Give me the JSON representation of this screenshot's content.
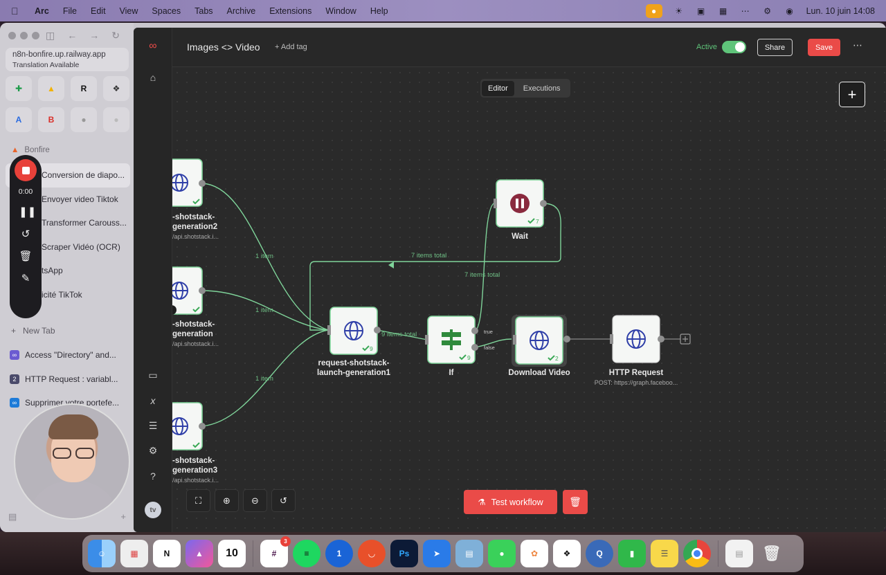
{
  "menubar": {
    "app": "Arc",
    "items": [
      "File",
      "Edit",
      "View",
      "Spaces",
      "Tabs",
      "Archive",
      "Extensions",
      "Window",
      "Help"
    ],
    "clock": "Lun. 10 juin  14:08"
  },
  "sidebar": {
    "url": "n8n-bonfire.up.railway.app",
    "url_note": "Translation Available",
    "space": "Bonfire",
    "tabs": [
      "Conversion de diapo...",
      "Envoyer video Tiktok",
      "Transformer Carouss...",
      "Scraper Vidéo (OCR)",
      "tsApp",
      "icité TikTok"
    ],
    "new_tab": "New Tab",
    "tabs2": [
      {
        "label": "Access \"Directory\" and...",
        "icon_color": "#6b5bd1"
      },
      {
        "label": "HTTP Request : variabl...",
        "icon_color": "#4a4a6a"
      },
      {
        "label": "Supprimer votre portefe...",
        "icon_color": "#1d7bd8"
      }
    ],
    "recorder": {
      "time": "0:00"
    }
  },
  "header": {
    "workflow_name": "Images <> Video",
    "add_tag": "+ Add tag",
    "active_label": "Active",
    "share": "Share",
    "save": "Save"
  },
  "canvas": {
    "tabs": {
      "editor": "Editor",
      "executions": "Executions"
    },
    "nodes": {
      "gen2": {
        "label_a": "-shotstack-",
        "label_b": "generation2",
        "sub": "/api.shotstack.i..."
      },
      "gen": {
        "label_a": "-shotstack-",
        "label_b": "generation",
        "sub": "/api.shotstack.i..."
      },
      "gen3": {
        "label_a": "-shotstack-",
        "label_b": "generation3",
        "sub": "/api.shotstack.i..."
      },
      "launch": {
        "label_a": "request-shotstack-",
        "label_b": "launch-generation1",
        "count": "9"
      },
      "if": {
        "label": "If",
        "count": "9",
        "true": "true",
        "false": "false"
      },
      "wait": {
        "label": "Wait",
        "count": "7"
      },
      "download": {
        "label": "Download Video",
        "count": "2"
      },
      "http": {
        "label": "HTTP Request",
        "sub": "POST: https://graph.faceboo..."
      }
    },
    "edges": {
      "e1": "1 item",
      "e2": "1 item",
      "e3": "1 item",
      "e4": "9 items total",
      "loop": "7 items total",
      "if_wait": "7 items total"
    },
    "test_workflow": "Test workflow"
  },
  "colors": {
    "accent": "#ea4b48",
    "active": "#5fc47a",
    "edge": "#7fd49a"
  }
}
